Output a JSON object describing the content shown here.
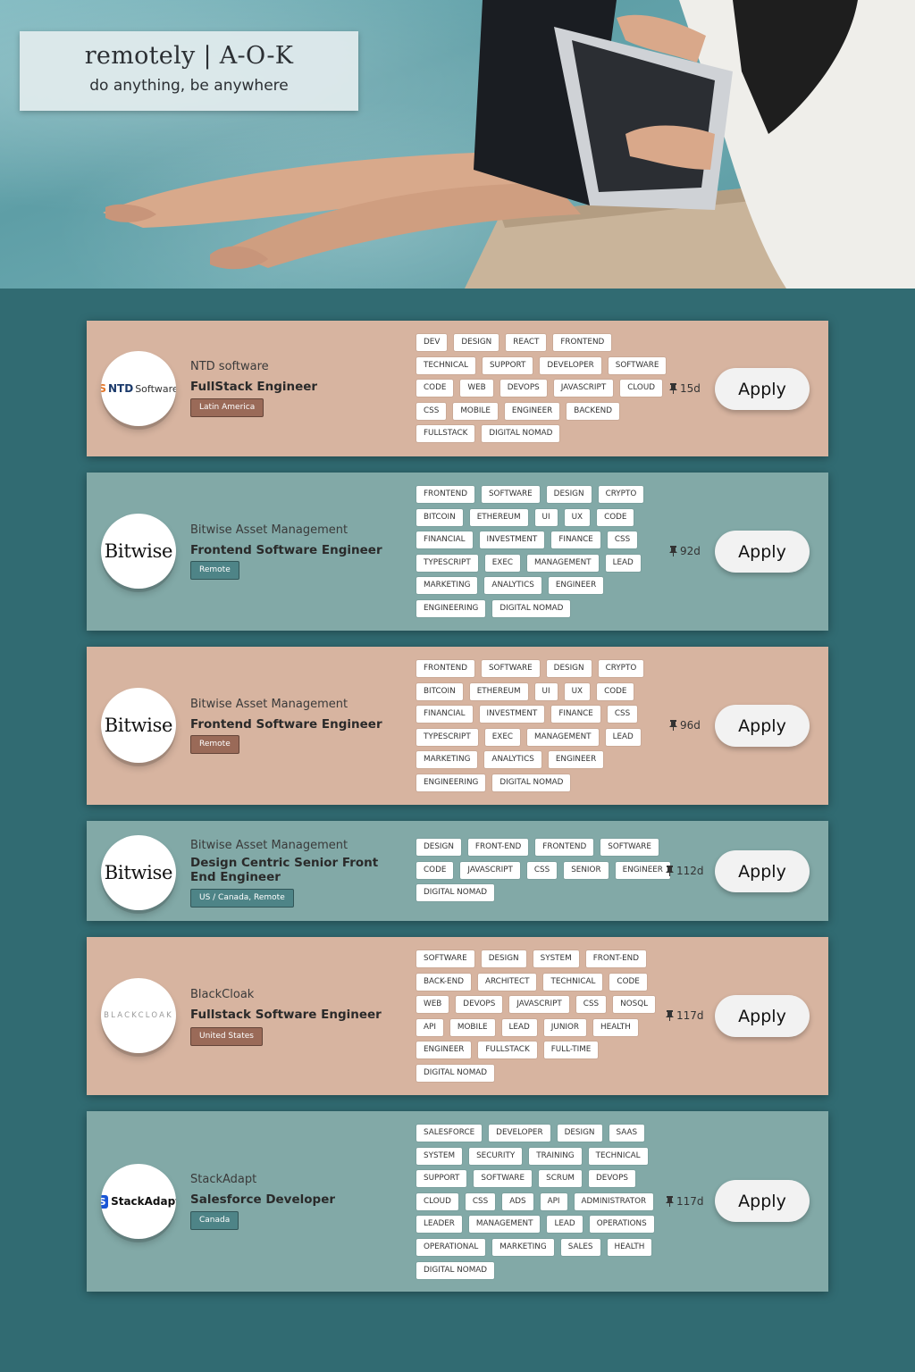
{
  "brand": {
    "title": "remotely | A-O-K",
    "tagline": "do anything, be anywhere"
  },
  "hero": {
    "image_alt": "woman with laptop sitting by a pool"
  },
  "colors": {
    "page_background": "#316b72",
    "card_peach": "#d7b4a0",
    "card_teal": "#82a9a7",
    "location_brown": "#9a6a58",
    "location_teal": "#4e8487",
    "apply_button": "#f2f2f2"
  },
  "apply_label": "Apply",
  "jobs": [
    {
      "company": "NTD software",
      "logo_text": "NTD Software",
      "title": "FullStack Engineer",
      "location": "Latin America",
      "age": "15d",
      "tags": [
        "DEV",
        "DESIGN",
        "REACT",
        "FRONTEND",
        "TECHNICAL",
        "SUPPORT",
        "DEVELOPER",
        "SOFTWARE",
        "CODE",
        "WEB",
        "DEVOPS",
        "JAVASCRIPT",
        "CLOUD",
        "CSS",
        "MOBILE",
        "ENGINEER",
        "BACKEND",
        "FULLSTACK",
        "DIGITAL NOMAD"
      ]
    },
    {
      "company": "Bitwise Asset Management",
      "logo_text": "Bitwise",
      "title": "Frontend Software Engineer",
      "location": "Remote",
      "age": "92d",
      "tags": [
        "FRONTEND",
        "SOFTWARE",
        "DESIGN",
        "CRYPTO",
        "BITCOIN",
        "ETHEREUM",
        "UI",
        "UX",
        "CODE",
        "FINANCIAL",
        "INVESTMENT",
        "FINANCE",
        "CSS",
        "TYPESCRIPT",
        "EXEC",
        "MANAGEMENT",
        "LEAD",
        "MARKETING",
        "ANALYTICS",
        "ENGINEER",
        "ENGINEERING",
        "DIGITAL NOMAD"
      ]
    },
    {
      "company": "Bitwise Asset Management",
      "logo_text": "Bitwise",
      "title": "Frontend Software Engineer",
      "location": "Remote",
      "age": "96d",
      "tags": [
        "FRONTEND",
        "SOFTWARE",
        "DESIGN",
        "CRYPTO",
        "BITCOIN",
        "ETHEREUM",
        "UI",
        "UX",
        "CODE",
        "FINANCIAL",
        "INVESTMENT",
        "FINANCE",
        "CSS",
        "TYPESCRIPT",
        "EXEC",
        "MANAGEMENT",
        "LEAD",
        "MARKETING",
        "ANALYTICS",
        "ENGINEER",
        "ENGINEERING",
        "DIGITAL NOMAD"
      ]
    },
    {
      "company": "Bitwise Asset Management",
      "logo_text": "Bitwise",
      "title": "Design Centric Senior Front End Engineer",
      "location": "US / Canada, Remote",
      "age": "112d",
      "tags": [
        "DESIGN",
        "FRONT-END",
        "FRONTEND",
        "SOFTWARE",
        "CODE",
        "JAVASCRIPT",
        "CSS",
        "SENIOR",
        "ENGINEER",
        "DIGITAL NOMAD"
      ]
    },
    {
      "company": "BlackCloak",
      "logo_text": "BLACKCLOAK",
      "title": "Fullstack Software Engineer",
      "location": "United States",
      "age": "117d",
      "tags": [
        "SOFTWARE",
        "DESIGN",
        "SYSTEM",
        "FRONT-END",
        "BACK-END",
        "ARCHITECT",
        "TECHNICAL",
        "CODE",
        "WEB",
        "DEVOPS",
        "JAVASCRIPT",
        "CSS",
        "NOSQL",
        "API",
        "MOBILE",
        "LEAD",
        "JUNIOR",
        "HEALTH",
        "ENGINEER",
        "FULLSTACK",
        "FULL-TIME",
        "DIGITAL NOMAD"
      ]
    },
    {
      "company": "StackAdapt",
      "logo_text": "StackAdapt",
      "title": "Salesforce Developer",
      "location": "Canada",
      "age": "117d",
      "tags": [
        "SALESFORCE",
        "DEVELOPER",
        "DESIGN",
        "SAAS",
        "SYSTEM",
        "SECURITY",
        "TRAINING",
        "TECHNICAL",
        "SUPPORT",
        "SOFTWARE",
        "SCRUM",
        "DEVOPS",
        "CLOUD",
        "CSS",
        "ADS",
        "API",
        "ADMINISTRATOR",
        "LEADER",
        "MANAGEMENT",
        "LEAD",
        "OPERATIONS",
        "OPERATIONAL",
        "MARKETING",
        "SALES",
        "HEALTH",
        "DIGITAL NOMAD"
      ]
    }
  ]
}
